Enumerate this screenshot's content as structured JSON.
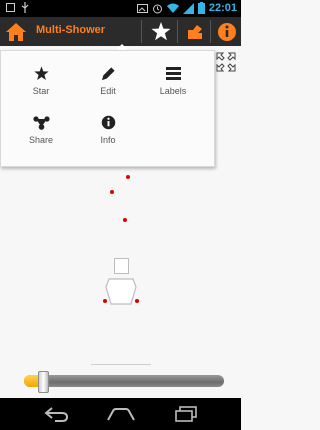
{
  "status_bar": {
    "time": "22:01",
    "icons": [
      "notification-square-icon",
      "usb-icon",
      "photo-icon",
      "alarm-icon",
      "wifi-icon",
      "signal-icon",
      "battery-icon"
    ]
  },
  "action_bar": {
    "title": "Multi-Shower",
    "icons": [
      "home-icon",
      "star-icon",
      "share-icon",
      "info-icon"
    ],
    "accent_color": "#ff7f1e"
  },
  "menu": {
    "items": [
      {
        "label": "Star",
        "icon": "star-icon"
      },
      {
        "label": "Edit",
        "icon": "pencil-icon"
      },
      {
        "label": "Labels",
        "icon": "labels-icon"
      },
      {
        "label": "Share",
        "icon": "share-icon"
      },
      {
        "label": "Info",
        "icon": "info-icon"
      }
    ]
  },
  "canvas": {
    "dot_color": "#e00000"
  },
  "slider": {
    "value_fraction": 0.08,
    "fill_color": "#f2a900"
  },
  "nav_bar": {
    "icons": [
      "back-icon",
      "home-nav-icon",
      "recent-apps-icon"
    ]
  }
}
